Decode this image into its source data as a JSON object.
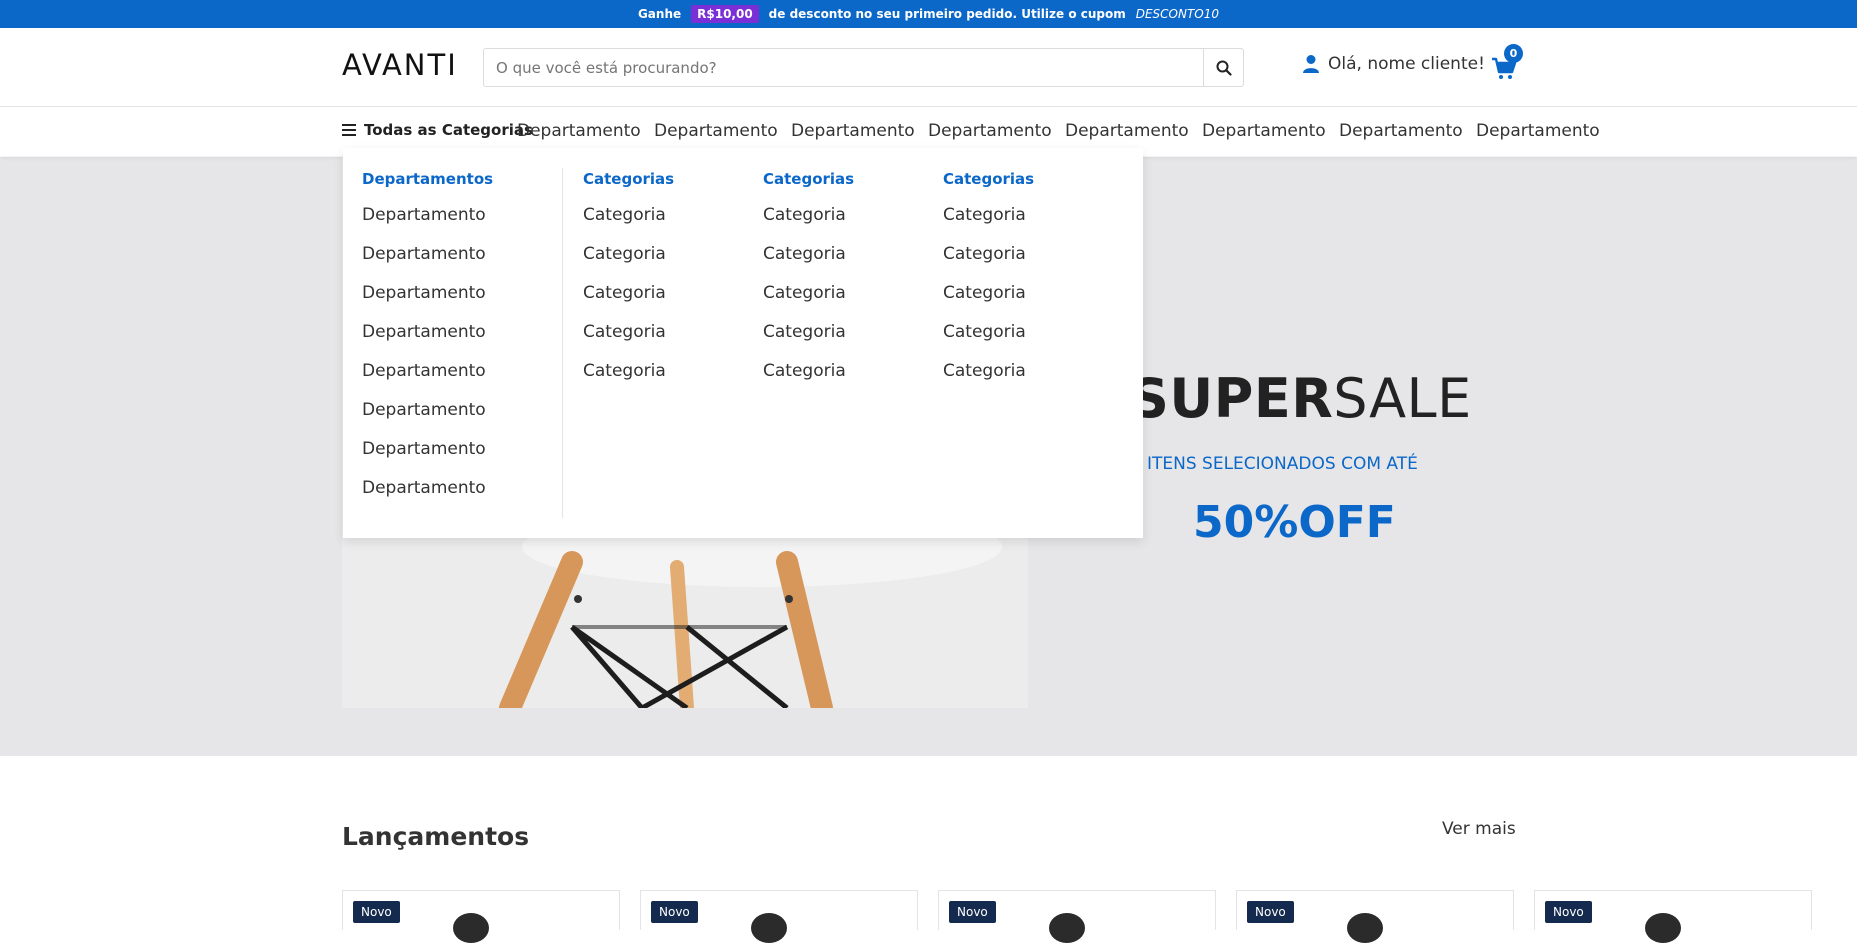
{
  "promo": {
    "prefix": "Ganhe",
    "amount": "R$10,00",
    "middle": "de desconto no seu primeiro pedido. Utilize o cupom",
    "coupon": "DESCONTO10"
  },
  "header": {
    "logo": "AVANTI",
    "search_placeholder": "O que você está procurando?",
    "greeting": "Olá, nome cliente!",
    "cart_count": "0"
  },
  "nav": {
    "all_categories": "Todas as Categorias",
    "departments": [
      "Departamento",
      "Departamento",
      "Departamento",
      "Departamento",
      "Departamento",
      "Departamento",
      "Departamento",
      "Departamento"
    ]
  },
  "dropdown": {
    "columns": [
      {
        "title": "Departamentos",
        "items": [
          "Departamento",
          "Departamento",
          "Departamento",
          "Departamento",
          "Departamento",
          "Departamento",
          "Departamento",
          "Departamento"
        ]
      },
      {
        "title": "Categorias",
        "items": [
          "Categoria",
          "Categoria",
          "Categoria",
          "Categoria",
          "Categoria"
        ]
      },
      {
        "title": "Categorias",
        "items": [
          "Categoria",
          "Categoria",
          "Categoria",
          "Categoria",
          "Categoria"
        ]
      },
      {
        "title": "Categorias",
        "items": [
          "Categoria",
          "Categoria",
          "Categoria",
          "Categoria",
          "Categoria"
        ]
      }
    ]
  },
  "hero": {
    "title_bold": "SUPER",
    "title_light": "SALE",
    "subtitle": "ITENS SELECIONADOS COM ATÉ",
    "discount": "50%OFF"
  },
  "launches": {
    "title": "Lançamentos",
    "see_more": "Ver mais",
    "badge": "Novo"
  },
  "colors": {
    "brand_blue": "#0b67c8",
    "promo_badge": "#7b2fd6",
    "new_badge": "#142a4e",
    "hero_bg": "#e6e6e8"
  }
}
